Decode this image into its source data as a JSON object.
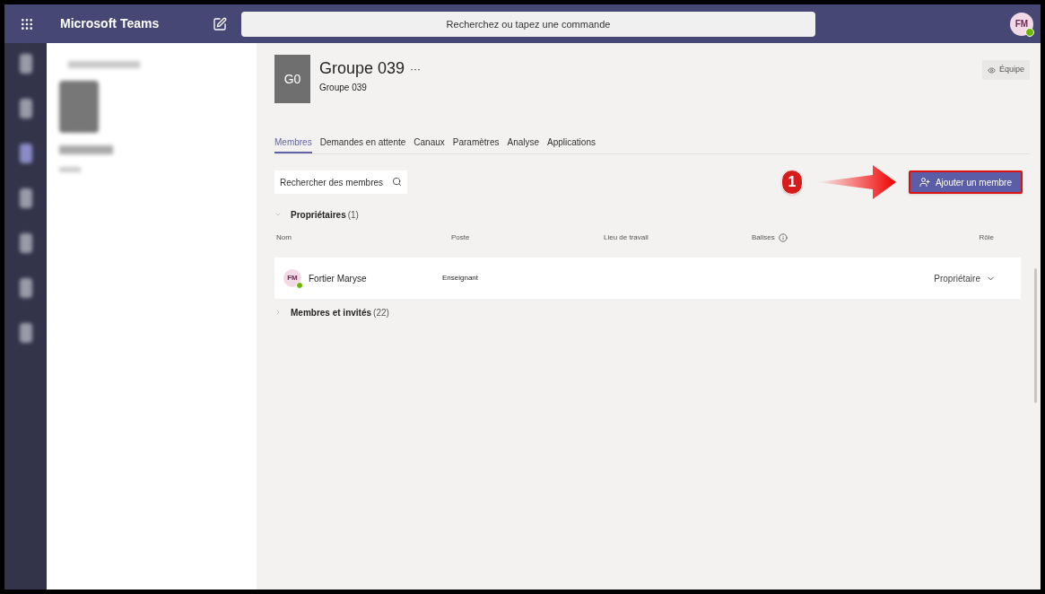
{
  "app": {
    "title": "Microsoft Teams",
    "user_initials": "FM",
    "user_online": true
  },
  "search": {
    "placeholder": "Recherchez ou tapez une commande"
  },
  "team": {
    "avatar": "G0",
    "name": "Groupe 039",
    "more": "···",
    "subtitle": "Groupe 039",
    "team_button": "Équipe"
  },
  "tabs": [
    {
      "label": "Membres",
      "selected": true
    },
    {
      "label": "Demandes en attente",
      "selected": false
    },
    {
      "label": "Canaux",
      "selected": false
    },
    {
      "label": "Paramètres",
      "selected": false
    },
    {
      "label": "Analyse",
      "selected": false
    },
    {
      "label": "Applications",
      "selected": false
    }
  ],
  "member_search": {
    "placeholder": "Rechercher des membres"
  },
  "add_member_button": "Ajouter un membre",
  "annotation": {
    "number": "1"
  },
  "table": {
    "columns": [
      "Nom",
      "Poste",
      "Lieu de travail",
      "Balises",
      "Rôle"
    ],
    "sections": [
      {
        "title": "Propriétaires",
        "count": "(1)",
        "expanded": true,
        "rows": [
          {
            "initials": "FM",
            "online": true,
            "name": "Fortier Maryse",
            "title": "Enseignant",
            "role": "Propriétaire"
          }
        ]
      },
      {
        "title": "Membres et invités",
        "count": "(22)",
        "expanded": false
      }
    ]
  }
}
